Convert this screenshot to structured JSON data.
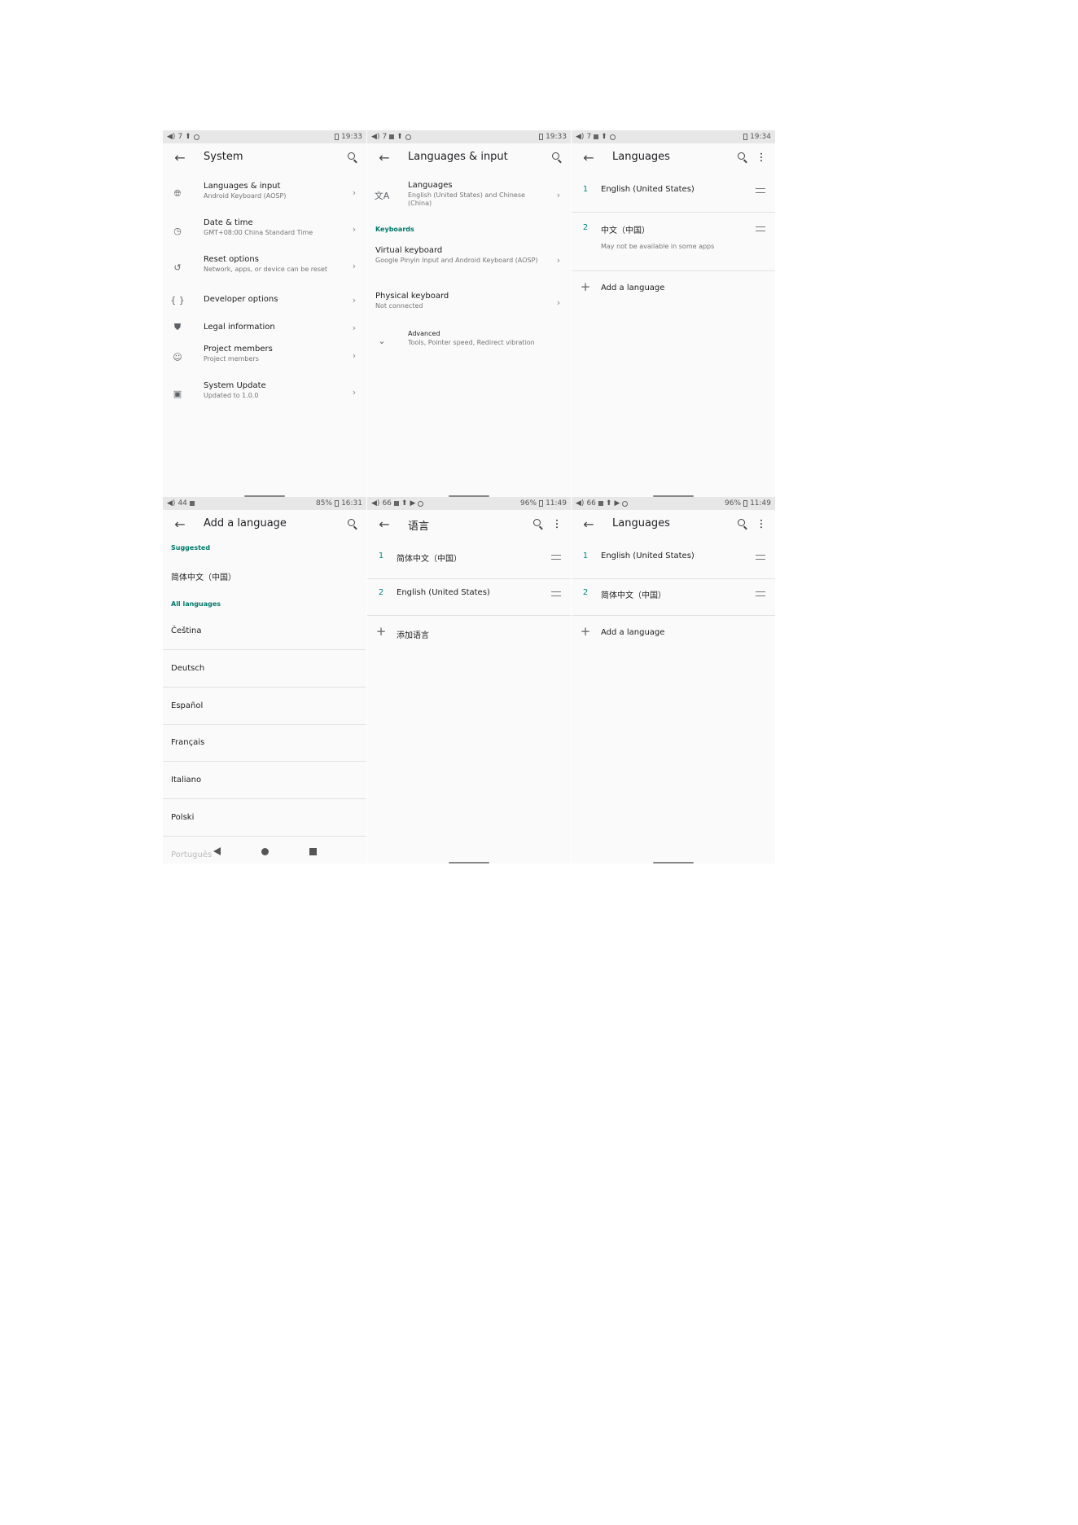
{
  "s1": {
    "status": {
      "left": "7",
      "time": "19:33"
    },
    "title": "System",
    "items": [
      {
        "title": "Languages & input",
        "sub": "Android Keyboard (AOSP)"
      },
      {
        "title": "Date & time",
        "sub": "GMT+08:00 China Standard Time"
      },
      {
        "title": "Reset options",
        "sub": "Network, apps, or device can be reset"
      },
      {
        "title": "Developer options",
        "sub": ""
      },
      {
        "title": "Legal information",
        "sub": ""
      },
      {
        "title": "Project members",
        "sub": "Project members"
      },
      {
        "title": "System Update",
        "sub": "Updated to  1.0.0"
      }
    ]
  },
  "s2": {
    "status": {
      "left": "7",
      "time": "19:33"
    },
    "title": "Languages & input",
    "languages": {
      "title": "Languages",
      "sub": "English (United States) and Chinese (China)"
    },
    "keyboards_header": "Keyboards",
    "virtual": {
      "title": "Virtual keyboard",
      "sub": "Google Pinyin Input and Android Keyboard (AOSP)"
    },
    "physical": {
      "title": "Physical keyboard",
      "sub": "Not connected"
    },
    "advanced": {
      "title": "Advanced",
      "sub": "Tools, Pointer speed, Redirect vibration"
    }
  },
  "s3": {
    "status": {
      "left": "7",
      "time": "19:34"
    },
    "title": "Languages",
    "langs": [
      {
        "num": "1",
        "name": "English (United States)"
      },
      {
        "num": "2",
        "name": "中文（中国）",
        "note": "May not be available in some apps"
      }
    ],
    "add": "Add a language"
  },
  "s4": {
    "status": {
      "left": "44",
      "battery": "85%",
      "time": "16:31"
    },
    "title": "Add a language",
    "suggested_header": "Suggested",
    "suggested": "简体中文（中国）",
    "all_header": "All languages",
    "langs": [
      "Čeština",
      "Deutsch",
      "Español",
      "Français",
      "Italiano",
      "Polski",
      "Português"
    ]
  },
  "s5": {
    "status": {
      "left": "66",
      "battery": "96%",
      "time": "11:49"
    },
    "title": "语言",
    "langs": [
      {
        "num": "1",
        "name": "简体中文（中国）"
      },
      {
        "num": "2",
        "name": "English (United States)"
      }
    ],
    "add": "添加语言"
  },
  "s6": {
    "status": {
      "left": "66",
      "battery": "96%",
      "time": "11:49"
    },
    "title": "Languages",
    "langs": [
      {
        "num": "1",
        "name": "English (United States)"
      },
      {
        "num": "2",
        "name": "简体中文（中国）"
      }
    ],
    "add": "Add a language"
  }
}
